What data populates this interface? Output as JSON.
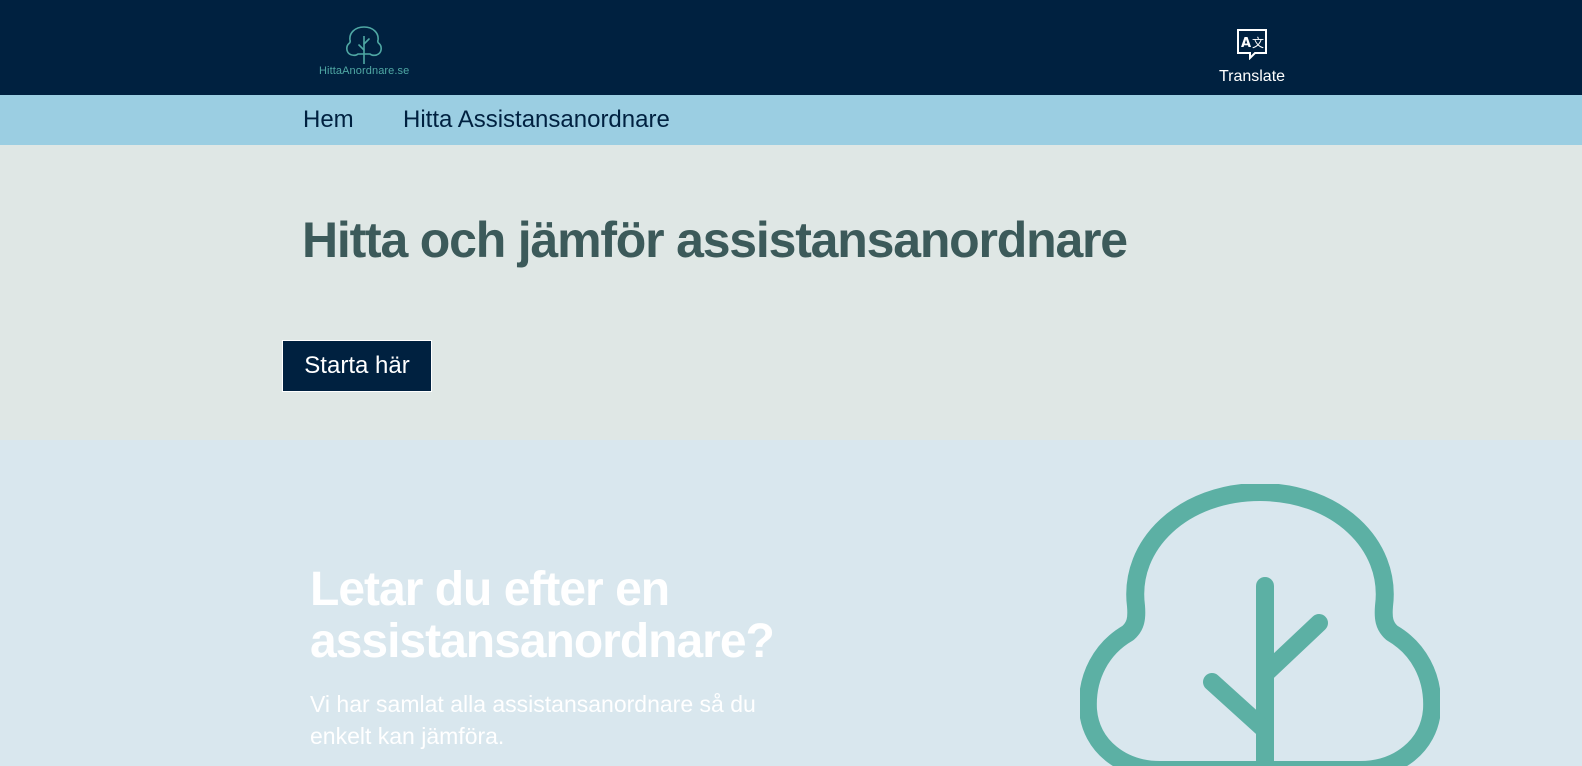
{
  "header": {
    "logo_text": "HittaAnordnare.se",
    "logo_icon": "tree-icon",
    "translate_label": "Translate",
    "translate_icon": "translate-icon"
  },
  "nav": {
    "items": [
      {
        "label": "Hem"
      },
      {
        "label": "Hitta Assistansanordnare"
      }
    ]
  },
  "hero": {
    "title": "Hitta och jämför assistansanordnare",
    "cta_label": "Starta här"
  },
  "intro": {
    "title": "Letar du efter en assistansanordnare?",
    "text": "Vi har samlat alla assistansanordnare så du enkelt kan jämföra.",
    "illustration": "tree-icon"
  },
  "colors": {
    "header_bg": "#002140",
    "nav_bg": "#9bcee2",
    "hero_bg": "#dfe7e5",
    "section_bg": "#d9e7ee",
    "accent_teal": "#5cb0a4",
    "hero_title": "#3c5a5a"
  }
}
